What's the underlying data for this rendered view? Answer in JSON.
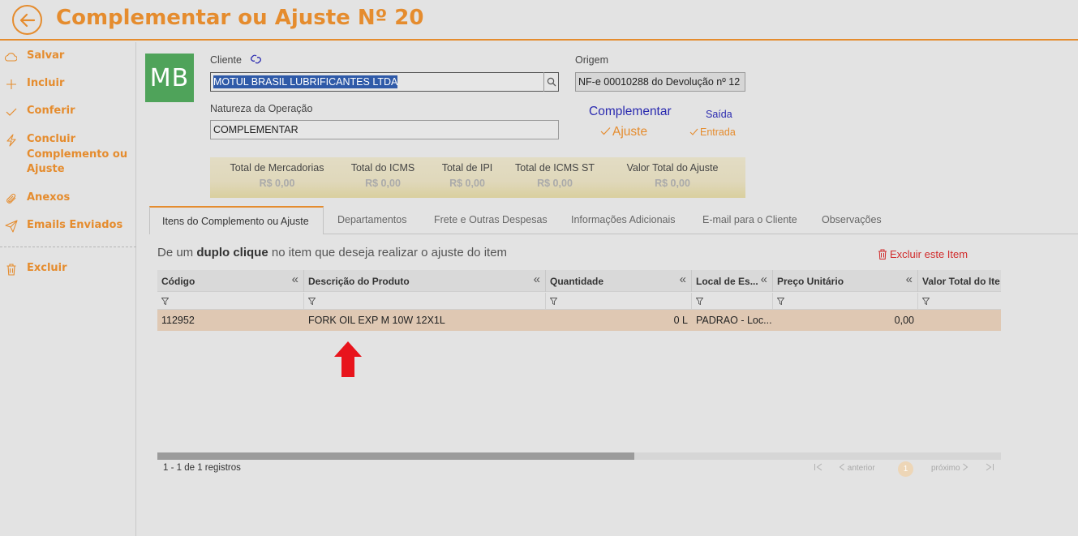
{
  "header": {
    "title": "Complementar ou Ajuste Nº 20"
  },
  "sidebar": {
    "items": [
      {
        "label": "Salvar",
        "icon": "cloud-icon"
      },
      {
        "label": "Incluir",
        "icon": "plus-icon"
      },
      {
        "label": "Conferir",
        "icon": "check-icon"
      },
      {
        "label": "Concluir Complemento ou Ajuste",
        "icon": "bolt-icon"
      },
      {
        "label": "Anexos",
        "icon": "paperclip-icon"
      },
      {
        "label": "Emails Enviados",
        "icon": "send-icon"
      },
      {
        "label": "Excluir",
        "icon": "trash-icon"
      }
    ]
  },
  "avatar": {
    "initials": "MB",
    "color": "#4fa35a"
  },
  "form": {
    "cliente_label": "Cliente",
    "cliente_value": "MOTUL BRASIL LUBRIFICANTES LTDA",
    "origem_label": "Origem",
    "origem_value": "NF-e 00010288 do Devolução nº 12",
    "natureza_label": "Natureza da Operação",
    "natureza_value": "COMPLEMENTAR",
    "option_complementar": "Complementar",
    "option_ajuste": "Ajuste",
    "option_saida": "Saída",
    "option_entrada": "Entrada"
  },
  "totals": [
    {
      "label": "Total de Mercadorias",
      "value": "R$ 0,00"
    },
    {
      "label": "Total do ICMS",
      "value": "R$ 0,00"
    },
    {
      "label": "Total de IPI",
      "value": "R$ 0,00"
    },
    {
      "label": "Total de ICMS ST",
      "value": "R$ 0,00"
    },
    {
      "label": "Valor Total do Ajuste",
      "value": "R$ 0,00"
    }
  ],
  "tabs": [
    "Itens do Complemento ou Ajuste",
    "Departamentos",
    "Frete e Outras Despesas",
    "Informações Adicionais",
    "E-mail para o Cliente",
    "Observações"
  ],
  "hint": {
    "prefix": "De um ",
    "bold": "duplo clique",
    "suffix": " no item que deseja realizar o ajuste do item"
  },
  "delete_item_label": "Excluir este Item",
  "grid": {
    "columns": [
      "Código",
      "Descrição do Produto",
      "Quantidade",
      "Local de Es...",
      "Preço Unitário",
      "Valor Total do Ite"
    ],
    "rows": [
      {
        "codigo": "112952",
        "descricao": "FORK OIL EXP M 10W 12X1L",
        "quantidade": "0 L",
        "local": "PADRAO - Loc...",
        "preco": "0,00",
        "total": ""
      }
    ]
  },
  "footer": {
    "records": "1 - 1 de 1 registros",
    "prev": "anterior",
    "next": "próximo",
    "page": "1"
  },
  "colors": {
    "accent": "#e58c2e",
    "selected_row": "#dfc8b3",
    "link_blue": "#2a2ab0",
    "danger": "#d12b2b"
  }
}
